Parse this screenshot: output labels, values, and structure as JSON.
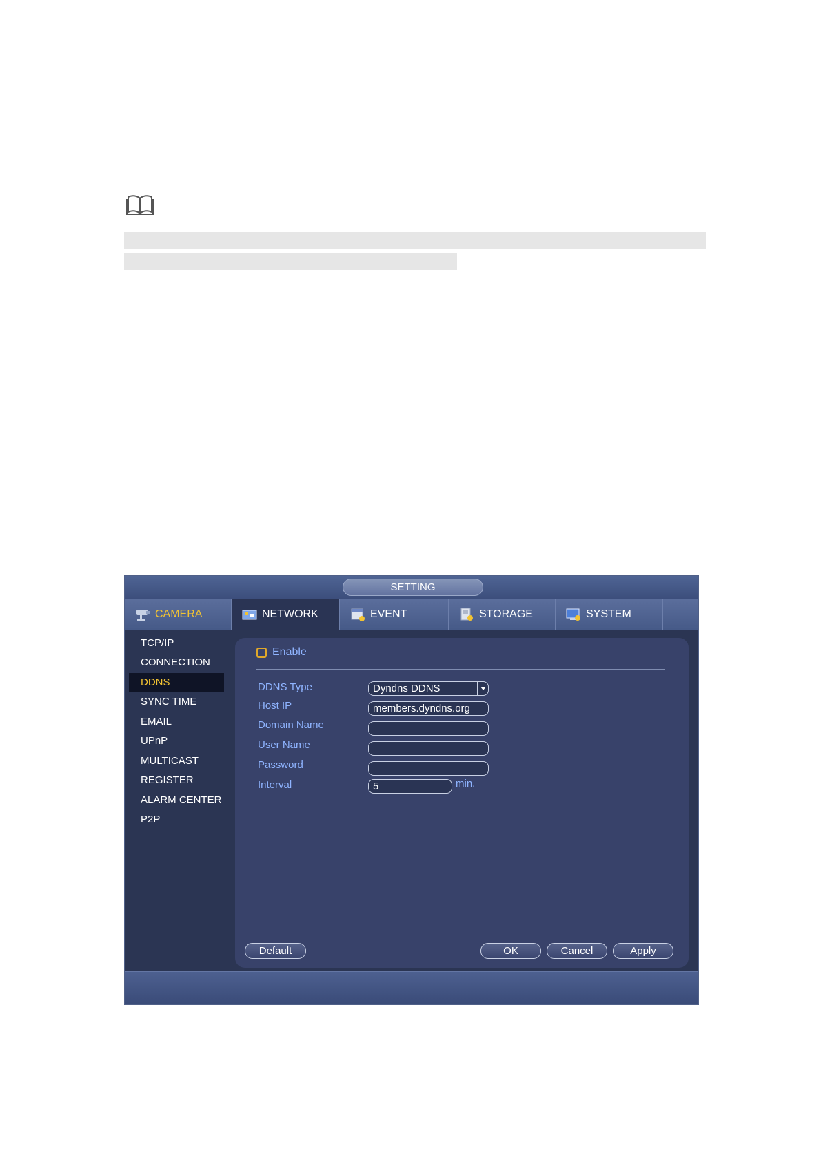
{
  "window": {
    "title": "SETTING"
  },
  "tabs": [
    {
      "label": "CAMERA",
      "icon": "camera-icon"
    },
    {
      "label": "NETWORK",
      "icon": "network-icon"
    },
    {
      "label": "EVENT",
      "icon": "event-icon"
    },
    {
      "label": "STORAGE",
      "icon": "storage-icon"
    },
    {
      "label": "SYSTEM",
      "icon": "system-icon"
    }
  ],
  "sidebar": {
    "items": [
      {
        "label": "TCP/IP"
      },
      {
        "label": "CONNECTION"
      },
      {
        "label": "DDNS"
      },
      {
        "label": "SYNC TIME"
      },
      {
        "label": "EMAIL"
      },
      {
        "label": "UPnP"
      },
      {
        "label": "MULTICAST"
      },
      {
        "label": "REGISTER"
      },
      {
        "label": "ALARM CENTER"
      },
      {
        "label": "P2P"
      }
    ],
    "selected": "DDNS"
  },
  "form": {
    "enable_label": "Enable",
    "enabled": false,
    "fields": [
      {
        "label": "DDNS Type",
        "value": "Dyndns DDNS"
      },
      {
        "label": "Host IP",
        "value": "members.dyndns.org"
      },
      {
        "label": "Domain Name",
        "value": ""
      },
      {
        "label": "User Name",
        "value": ""
      },
      {
        "label": "Password",
        "value": ""
      },
      {
        "label": "Interval",
        "value": "5"
      }
    ],
    "interval_unit": "min."
  },
  "buttons": {
    "default": "Default",
    "ok": "OK",
    "cancel": "Cancel",
    "apply": "Apply"
  },
  "colors": {
    "accent_yellow": "#f2c332",
    "label_blue": "#8fb4ff",
    "panel_bg": "#38426a",
    "window_bg": "#2b3553"
  }
}
